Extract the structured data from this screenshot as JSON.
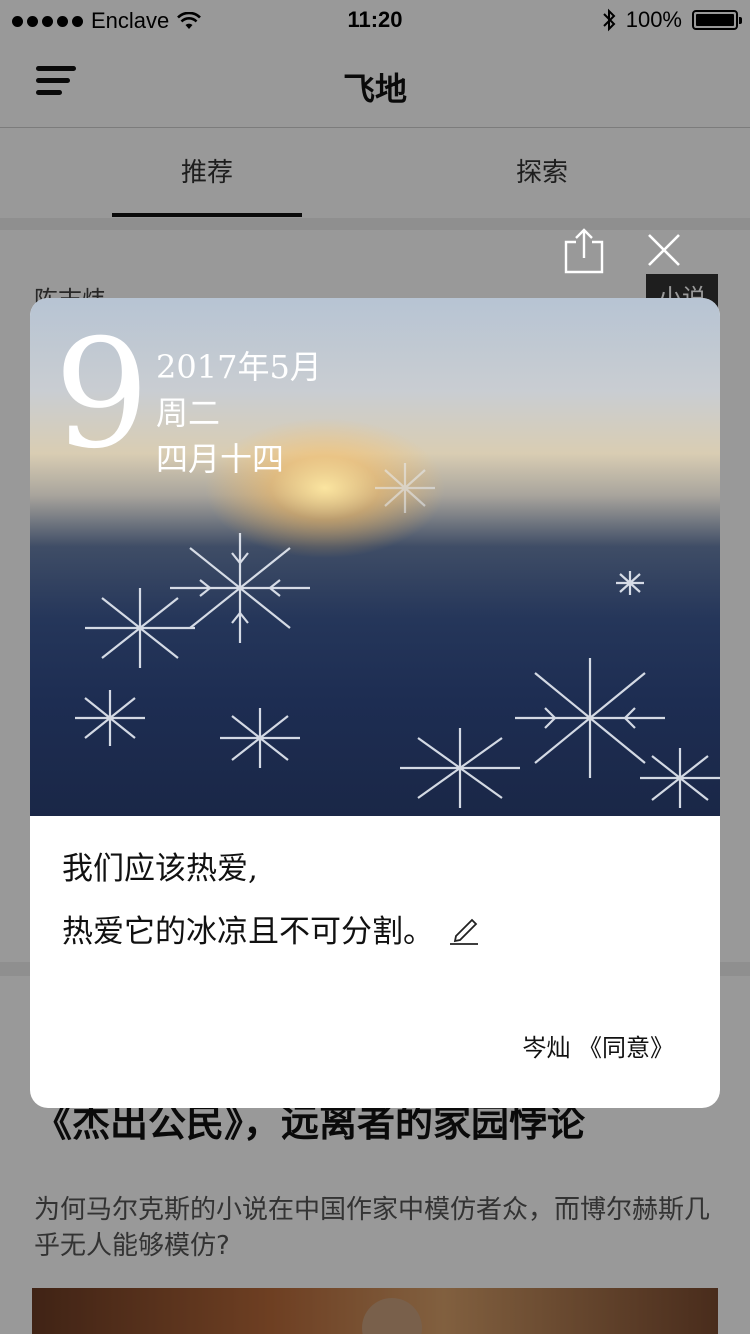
{
  "status_bar": {
    "carrier": "Enclave",
    "time": "11:20",
    "battery": "100%"
  },
  "nav": {
    "title": "飞地"
  },
  "tabs": [
    {
      "label": "推荐",
      "active": true
    },
    {
      "label": "探索",
      "active": false
    }
  ],
  "article": {
    "author": "陈志炜",
    "tag": "小说",
    "headline": "《杰出公民》，远离者的家园悖论",
    "summary": "为何马尔克斯的小说在中国作家中模仿者众，而博尔赫斯几乎无人能够模仿?"
  },
  "card": {
    "day": "9",
    "date_line": "2017年5月",
    "weekday": "周二",
    "lunar_date": "四月十四",
    "quote_lines": [
      "我们应该热爱,",
      "热爱它的冰凉且不可分割。"
    ],
    "attribution": "岑灿 《同意》"
  },
  "icons": {
    "menu": "menu-icon",
    "share": "share-icon",
    "close": "close-icon",
    "edit": "edit-icon",
    "wifi": "wifi-icon",
    "bluetooth": "bluetooth-icon",
    "battery": "battery-icon"
  }
}
